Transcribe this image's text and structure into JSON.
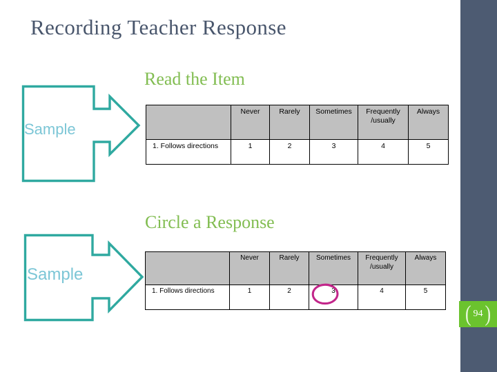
{
  "slide": {
    "title": "Recording Teacher Response",
    "page_number": "94",
    "paren_left": "(",
    "paren_right": ")",
    "colors": {
      "title_text": "#49566c",
      "heading_green": "#82bd52",
      "sidebar": "#4d5b72",
      "badge_green": "#6bc32e",
      "callout_teal": "#2fa9a0",
      "callout_label_teal": "#7cc6d6",
      "table_header_fill": "#c0c0c0",
      "circle_magenta": "#c2268a"
    }
  },
  "sections": [
    {
      "heading": "Read the Item",
      "callout_label": "Sample",
      "table": {
        "headers": [
          "",
          "Never",
          "Rarely",
          "Sometimes",
          "Frequently\n/usually",
          "Always"
        ],
        "header_lines": [
          [
            ""
          ],
          [
            "Never"
          ],
          [
            "Rarely"
          ],
          [
            "Sometimes"
          ],
          [
            "Frequently",
            "/usually"
          ],
          [
            "Always"
          ]
        ],
        "rows": [
          [
            "1.  Follows directions",
            "1",
            "2",
            "3",
            "4",
            "5"
          ]
        ],
        "circled_value": null
      }
    },
    {
      "heading": "Circle a Response",
      "callout_label": "Sample",
      "table": {
        "headers": [
          "",
          "Never",
          "Rarely",
          "Sometimes",
          "Frequently\n/usually",
          "Always"
        ],
        "header_lines": [
          [
            ""
          ],
          [
            "Never"
          ],
          [
            "Rarely"
          ],
          [
            "Sometimes"
          ],
          [
            "Frequently",
            "/usually"
          ],
          [
            "Always"
          ]
        ],
        "rows": [
          [
            "1.  Follows directions",
            "1",
            "2",
            "3",
            "4",
            "5"
          ]
        ],
        "circled_value": "3"
      }
    }
  ]
}
